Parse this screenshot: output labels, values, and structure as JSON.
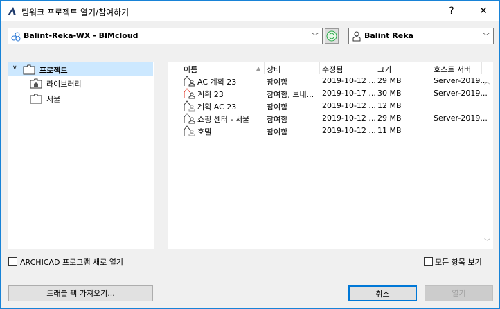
{
  "window": {
    "title": "팀워크 프로젝트 열기/참여하기",
    "help": "?",
    "close": "✕"
  },
  "server": {
    "value": "Balint-Reka-WX - BIMcloud"
  },
  "user": {
    "value": "Balint Reka"
  },
  "tree": [
    {
      "label": "프로젝트"
    },
    {
      "label": "라이브러리"
    },
    {
      "label": "서울"
    }
  ],
  "columns": [
    "이름",
    "상태",
    "수정됨",
    "크기",
    "호스트 서버"
  ],
  "rows": [
    {
      "name": "AC 계획 23",
      "status": "참여함",
      "modified": "2019-10-12 ...",
      "size": "29 MB",
      "host": "Server-2019...",
      "icon": "red-false"
    },
    {
      "name": "계획 23",
      "status": "참여함, 보내...",
      "modified": "2019-10-17 ...",
      "size": "30 MB",
      "host": "Server-2019...",
      "icon": "red"
    },
    {
      "name": "계획 AC 23",
      "status": "참여함",
      "modified": "2019-10-12 ...",
      "size": "12 MB",
      "host": "",
      "icon": "grey"
    },
    {
      "name": "쇼핑 센터 - 서울",
      "status": "참여함",
      "modified": "2019-10-12 ...",
      "size": "29 MB",
      "host": "Server-2019...",
      "icon": "dark"
    },
    {
      "name": "호텔",
      "status": "참여함",
      "modified": "2019-10-12 ...",
      "size": "11 MB",
      "host": "",
      "icon": "grey"
    }
  ],
  "options": {
    "new_instance": "ARCHICAD 프로그램 새로 열기",
    "show_all": "모든 항목 보기"
  },
  "buttons": {
    "travel_pack": "트래블 팩 가져오기...",
    "cancel": "취소",
    "open": "열기"
  }
}
